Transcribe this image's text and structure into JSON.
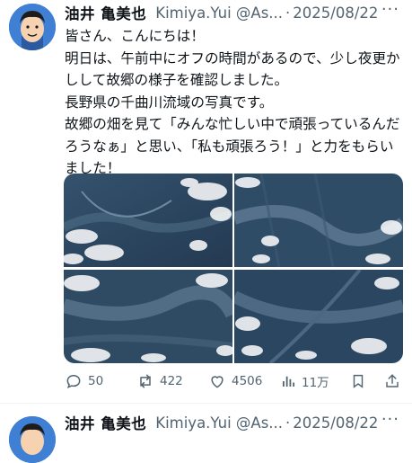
{
  "tweet1": {
    "author_name": "油井 亀美也",
    "author_handle": "Kimiya.Yui @As...",
    "separator": "·",
    "date": "2025/08/22",
    "more": "···",
    "text": "皆さん、こんにちは！\n明日は、午前中にオフの時間があるので、少し夜更かしして故郷の様子を確認しました。\n長野県の千曲川流域の写真です。\n故郷の畑を見て「みんな忙しい中で頑張っているんだろうなぁ」と思い、「私も頑張ろう！」と力をもらいました！",
    "actions": {
      "reply_count": "50",
      "repost_count": "422",
      "like_count": "4506",
      "view_count": "11万"
    },
    "icons": [
      "reply-icon",
      "repost-icon",
      "like-icon",
      "views-icon",
      "bookmark-icon",
      "share-icon"
    ]
  },
  "tweet2": {
    "author_name": "油井 亀美也",
    "author_handle": "Kimiya.Yui @As...",
    "separator": "·",
    "date": "2025/08/22",
    "more": "···"
  },
  "colors": {
    "text": "#0f1419",
    "secondary": "#536471",
    "avatar_bg": "#3f7fd4"
  }
}
